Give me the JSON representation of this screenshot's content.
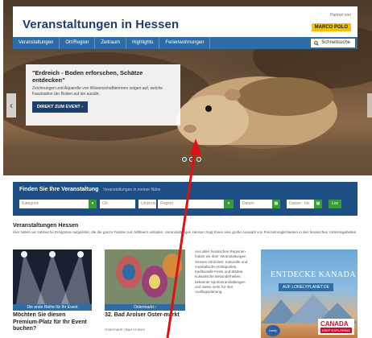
{
  "header": {
    "title": "Veranstaltungen in Hessen",
    "partner_label": "Partner von",
    "partner_logo": "MARCO POLO"
  },
  "nav": {
    "items": [
      "Veranstaltungen",
      "Ort/Region",
      "Zeitraum",
      "Highlights",
      "Ferienwohnungen"
    ],
    "search_label": "Schnellsuche",
    "search_icon": "search-icon"
  },
  "hero": {
    "title": "\"Erdreich - Boden erforschen, Schätze entdecken\"",
    "text": "Zeichnungen und Aquarelle von Wissenschaftlerinnen zeigen auf, welche Faszination der Boden auf sie ausübt.",
    "button": "DIREKT ZUM EVENT ›",
    "slide_count": 3,
    "active_slide": 1,
    "left_arrow": "‹"
  },
  "search": {
    "title": "Finden Sie Ihre Veranstaltung",
    "subtitle": "Veranstaltungen in meiner Nähe",
    "category_placeholder": "Kategorie",
    "place_placeholder": "Ort",
    "radius_placeholder": "Umkreis",
    "region_placeholder": "Region",
    "date_placeholder": "Datum",
    "date_to_placeholder": "Datum - bis",
    "go_label": "Los"
  },
  "section": {
    "title": "Veranstaltungen Hessen",
    "text": "Hier haben wir zahlreiche Ereignisse aufgelistet, die die ganze Familie zum Mitfeiern einladen. Veranstaltungen Hessen zeigt Ihnen eine große Auswahl von Freizeitmöglichkeiten in den hessischen Umkreisgebieten."
  },
  "cards": [
    {
      "category": "Die erste Reihe für Ihr Event",
      "title": "Möchten Sie diesen Premium-Platz für Ihr Event buchen?",
      "meta": ""
    },
    {
      "category": "Ostermarkt ›",
      "title": "32. Bad Arolser Oster-markt",
      "meta": "Ostermarkt | Bad Arolsen"
    }
  ],
  "info_text": "Aus allen hessischen Regionen haben wir über Veranstaltungen Hessen informiert. Kulturelle und musikalische Höhepunkte, traditionelle Feste und Märkte, kulinarische Besonderheiten, bekannte Sportveranstaltungen und vieles mehr für Ihre Ausflugsplanung.",
  "ad": {
    "title": "ENTDECKE KANADA",
    "subtitle": "AUF LONELYPLANET.DE",
    "canada": "CANADA",
    "canada_tag": "KEEP EXPLORING",
    "lp": "lonely planet"
  },
  "colors": {
    "nav": "#2d6ca6",
    "search_panel": "#1d4f86",
    "button_green": "#3a9a3a",
    "title_blue": "#1d3f6e",
    "annotation": "#e01010"
  }
}
